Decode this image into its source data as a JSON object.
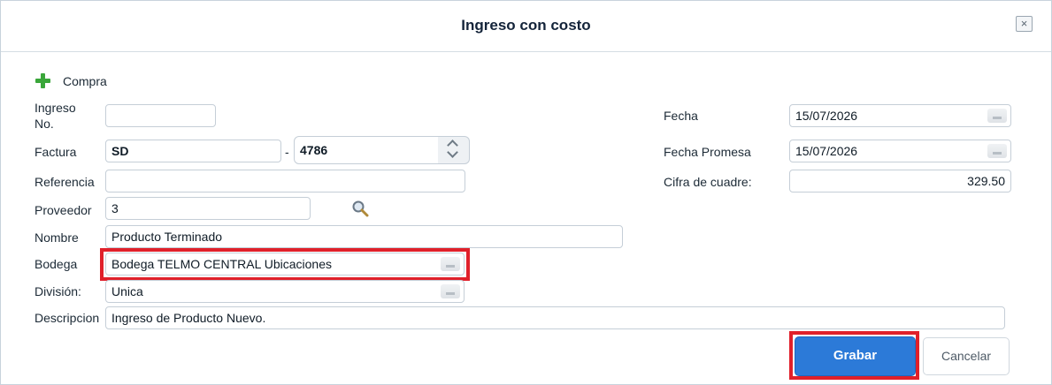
{
  "dialog": {
    "title": "Ingreso con costo",
    "close_symbol": "×"
  },
  "purchase_action": {
    "label": "Compra",
    "icon": "plus-icon"
  },
  "form": {
    "ingreso": {
      "label": "Ingreso No.",
      "value": ""
    },
    "factura": {
      "label": "Factura",
      "series": "SD",
      "separator": "-",
      "number": "4786"
    },
    "referencia": {
      "label": "Referencia",
      "value": ""
    },
    "proveedor": {
      "label": "Proveedor",
      "value": "3",
      "icon": "search-icon"
    },
    "nombre": {
      "label": "Nombre",
      "value": "Producto Terminado"
    },
    "bodega": {
      "label": "Bodega",
      "value": "Bodega TELMO CENTRAL Ubicaciones"
    },
    "division": {
      "label": "División:",
      "value": "Unica"
    },
    "descripcion": {
      "label": "Descripcion",
      "value": "Ingreso de Producto Nuevo."
    },
    "fecha": {
      "label": "Fecha",
      "value": "15/07/2026"
    },
    "fecha_promesa": {
      "label": "Fecha Promesa",
      "value": "15/07/2026"
    },
    "cifra_cuadre": {
      "label": "Cifra de cuadre:",
      "value": "329.50"
    }
  },
  "buttons": {
    "save": "Grabar",
    "cancel": "Cancelar"
  },
  "colors": {
    "primary": "#2c7ad8",
    "highlight": "#e0202a",
    "plus_icon": "#3aa63a"
  }
}
